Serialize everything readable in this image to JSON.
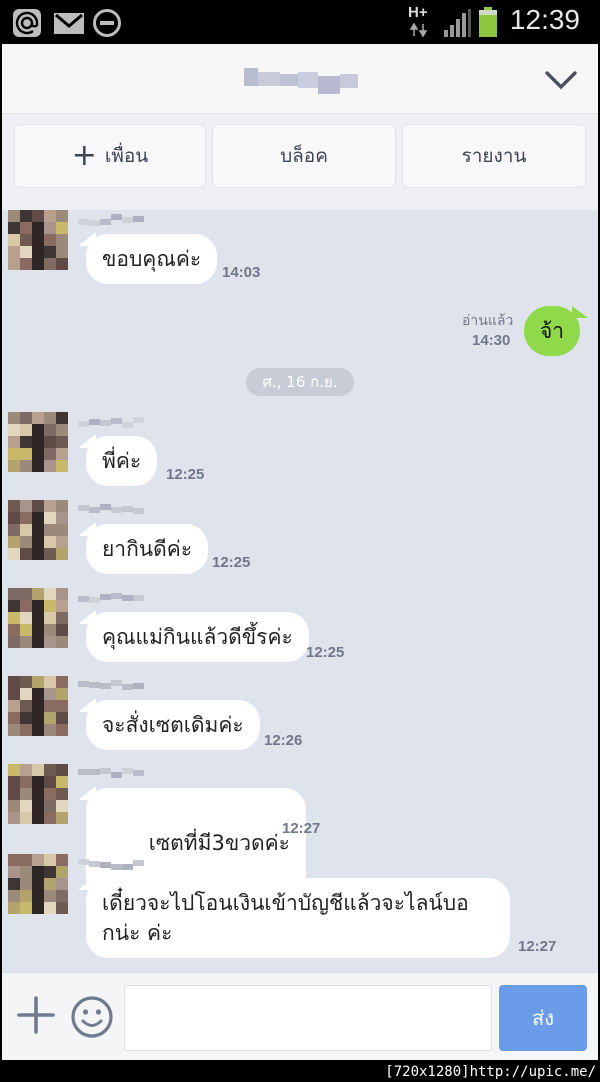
{
  "status_bar": {
    "network": "H+",
    "time": "12:39",
    "battery_color": "#8dc63f"
  },
  "header": {
    "title_blurred": true,
    "collapse_icon": "chevron-down-icon"
  },
  "actions": {
    "add_friend": "เพื่อน",
    "block": "บล็อค",
    "report": "รายงาน"
  },
  "messages": [
    {
      "from": "them",
      "text": "ขอบคุณค่ะ",
      "time": "14:03"
    },
    {
      "from": "me",
      "text": "จ้า",
      "time": "14:30",
      "read_label": "อ่านแล้ว"
    },
    {
      "from": "them",
      "text": "พี่ค่ะ",
      "time": "12:25"
    },
    {
      "from": "them",
      "text": "ยากินดีค่ะ",
      "time": "12:25"
    },
    {
      "from": "them",
      "text": "คุณแม่กินแล้วดีขึ้รค่ะ",
      "time": "12:25"
    },
    {
      "from": "them",
      "text": "จะสั่งเซตเดิมค่ะ",
      "time": "12:26"
    },
    {
      "from": "them",
      "text": " เซตที่มี3ขวดค่ะ",
      "time": "12:27"
    },
    {
      "from": "them",
      "text": "เดี๋ยวจะไปโอนเงินเข้าบัญชีแล้วจะไลน์บอกน่ะ ค่ะ",
      "time": "12:27"
    }
  ],
  "date_separator": "ศ., 16 ก.ย.",
  "input": {
    "placeholder": "",
    "send_label": "ส่ง"
  },
  "watermark": "[720x1280]http://upic.me/",
  "colors": {
    "chat_bg": "#dfe3ec",
    "my_bubble": "#8fd94a",
    "send_button": "#6a9ce9"
  }
}
